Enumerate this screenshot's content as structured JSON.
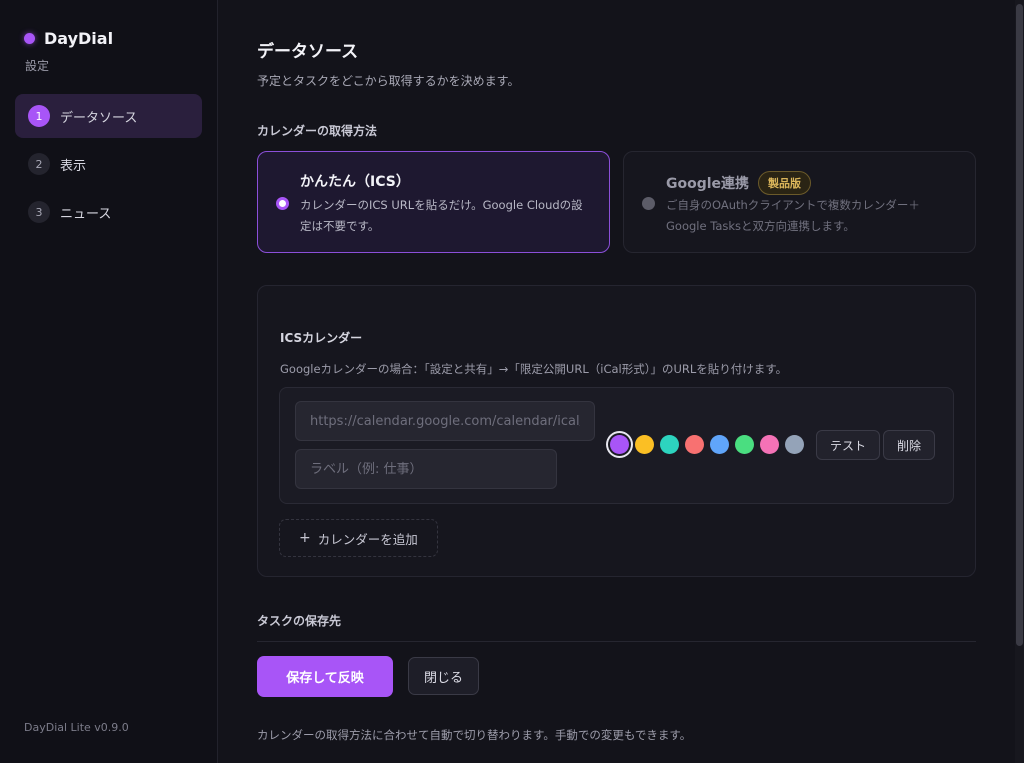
{
  "app": {
    "name": "DayDial",
    "subtitle": "設定",
    "version": "DayDial Lite v0.9.0",
    "accent": "#a855f7"
  },
  "sidebar": {
    "items": [
      {
        "num": "1",
        "label": "データソース",
        "active": true
      },
      {
        "num": "2",
        "label": "表示",
        "active": false
      },
      {
        "num": "3",
        "label": "ニュース",
        "active": false
      }
    ]
  },
  "main": {
    "title": "データソース",
    "description": "予定とタスクをどこから取得するかを決めます。",
    "calendar_method": {
      "label": "カレンダーの取得方法",
      "options": [
        {
          "title": "かんたん（ICS）",
          "desc": "カレンダーのICS URLを貼るだけ。Google Cloudの設定は不要です。",
          "selected": true
        },
        {
          "title": "Google連携",
          "badge": "製品版",
          "desc": "ご自身のOAuthクライアントで複数カレンダー＋Google Tasksと双方向連携します。",
          "selected": false
        }
      ]
    },
    "ics": {
      "title": "ICSカレンダー",
      "hint": "Googleカレンダーの場合：「設定と共有」→「限定公開URL（iCal形式）」のURLを貼り付けます。",
      "url_placeholder": "https://calendar.google.com/calendar/ical/...",
      "label_placeholder": "ラベル（例: 仕事）",
      "colors": [
        "#a855f7",
        "#fbbf24",
        "#2dd4bf",
        "#f87171",
        "#60a5fa",
        "#4ade80",
        "#f472b6",
        "#94a3b8"
      ],
      "selected_color": "#a855f7",
      "test_label": "テスト",
      "delete_label": "削除",
      "add_label": "カレンダーを追加"
    },
    "task_storage_label": "タスクの保存先",
    "save_label": "保存して反映",
    "close_label": "閉じる",
    "footer_note": "カレンダーの取得方法に合わせて自動で切り替わります。手動での変更もできます。"
  }
}
